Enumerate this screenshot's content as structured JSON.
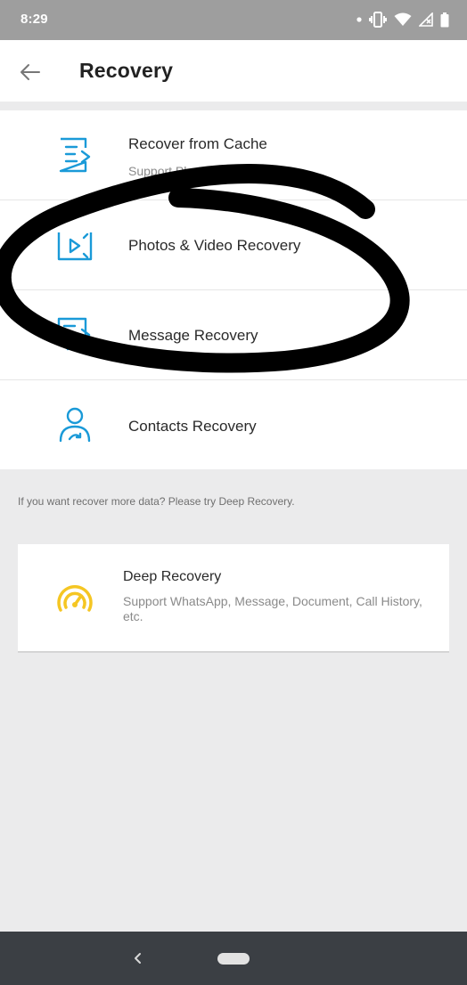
{
  "status_bar": {
    "time": "8:29",
    "icons": [
      "notification-dot-icon",
      "vibrate-icon",
      "wifi-icon",
      "signal-icon",
      "battery-icon"
    ]
  },
  "header": {
    "title": "Recovery",
    "back_icon": "arrow-left-icon"
  },
  "recovery_list": [
    {
      "title": "Recover from Cache",
      "subtitle": "Support Photos and Videos",
      "icon": "document-list-icon"
    },
    {
      "title": "Photos & Video Recovery",
      "subtitle": "",
      "icon": "video-play-icon"
    },
    {
      "title": "Message Recovery",
      "subtitle": "",
      "icon": "message-icon"
    },
    {
      "title": "Contacts Recovery",
      "subtitle": "",
      "icon": "contact-person-icon"
    }
  ],
  "hint": "If you want recover more data? Please try Deep Recovery.",
  "deep_recovery": {
    "title": "Deep Recovery",
    "subtitle": "Support WhatsApp, Message, Document, Call History, etc.",
    "icon": "speedometer-icon"
  },
  "colors": {
    "accent_blue": "#1a9ad8",
    "deep_yellow": "#f5c623",
    "scribble": "#000000"
  }
}
